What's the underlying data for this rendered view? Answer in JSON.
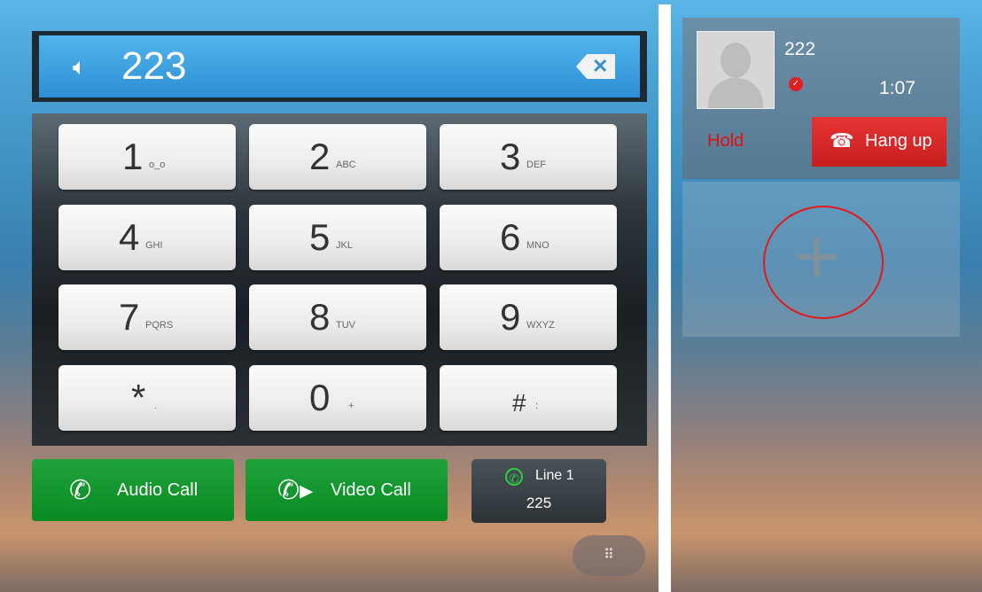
{
  "dial": {
    "number": "223",
    "speaker_icon": "speaker-icon",
    "backspace_icon": "backspace-icon"
  },
  "keypad": [
    {
      "digit": "1",
      "letters": "o_o"
    },
    {
      "digit": "2",
      "letters": "ABC"
    },
    {
      "digit": "3",
      "letters": "DEF"
    },
    {
      "digit": "4",
      "letters": "GHI"
    },
    {
      "digit": "5",
      "letters": "JKL"
    },
    {
      "digit": "6",
      "letters": "MNO"
    },
    {
      "digit": "7",
      "letters": "PQRS"
    },
    {
      "digit": "8",
      "letters": "TUV"
    },
    {
      "digit": "9",
      "letters": "WXYZ"
    },
    {
      "digit": "*",
      "letters": "."
    },
    {
      "digit": "0",
      "letters": "+"
    },
    {
      "digit": "#",
      "letters": ":"
    }
  ],
  "actions": {
    "audio_call": "Audio Call",
    "video_call": "Video Call",
    "line_label": "Line 1",
    "line_number": "225"
  },
  "active_call": {
    "caller": "222",
    "timer": "1:07",
    "hold": "Hold",
    "hang_up": "Hang up"
  },
  "add_call": {
    "symbol": "+"
  },
  "colors": {
    "call_green": "#0a8a22",
    "hangup_red": "#c81e1e",
    "hold_text": "#e01010",
    "display_blue": "#2d8fd3"
  }
}
